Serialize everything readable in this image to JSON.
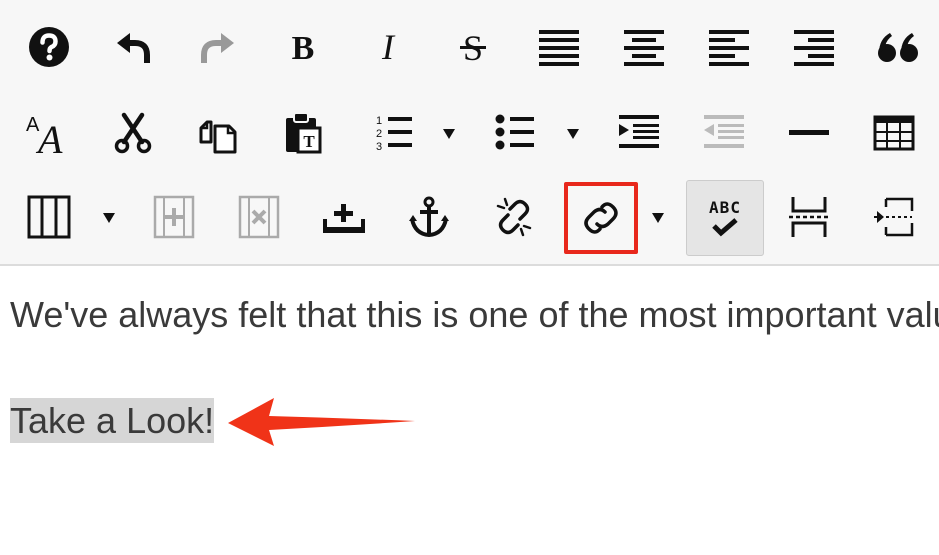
{
  "toolbar": {
    "rows": [
      [
        "help-icon",
        "undo-icon",
        "redo-icon",
        "bold-icon",
        "italic-icon",
        "strikethrough-icon",
        "align-justify-icon",
        "align-center-icon",
        "align-left-icon",
        "align-right-icon",
        "blockquote-icon"
      ],
      [
        "font-size-icon",
        "cut-icon",
        "copy-icon",
        "paste-text-icon",
        "ordered-list-icon",
        "unordered-list-icon",
        "indent-icon",
        "outdent-icon",
        "horizontal-rule-icon",
        "table-icon"
      ],
      [
        "columns-icon",
        "add-column-icon",
        "remove-column-icon",
        "insert-row-icon",
        "anchor-icon",
        "unlink-icon",
        "link-icon",
        "spellcheck-icon",
        "page-break-icon",
        "select-block-icon"
      ]
    ],
    "highlighted_button": "link-button",
    "active_button": "spellcheck-button",
    "disabled_buttons": [
      "redo-button",
      "outdent-button",
      "add-column-button",
      "remove-column-button"
    ],
    "spellcheck_label": "ABC",
    "highlight_color": "#e8281c"
  },
  "editor": {
    "paragraph_1": "We've always felt that this is one of the most important values",
    "paragraph_2": "Take a Look!",
    "selected_text_color": "#d6d6d6"
  },
  "annotation": {
    "arrow_color": "#f03318"
  }
}
